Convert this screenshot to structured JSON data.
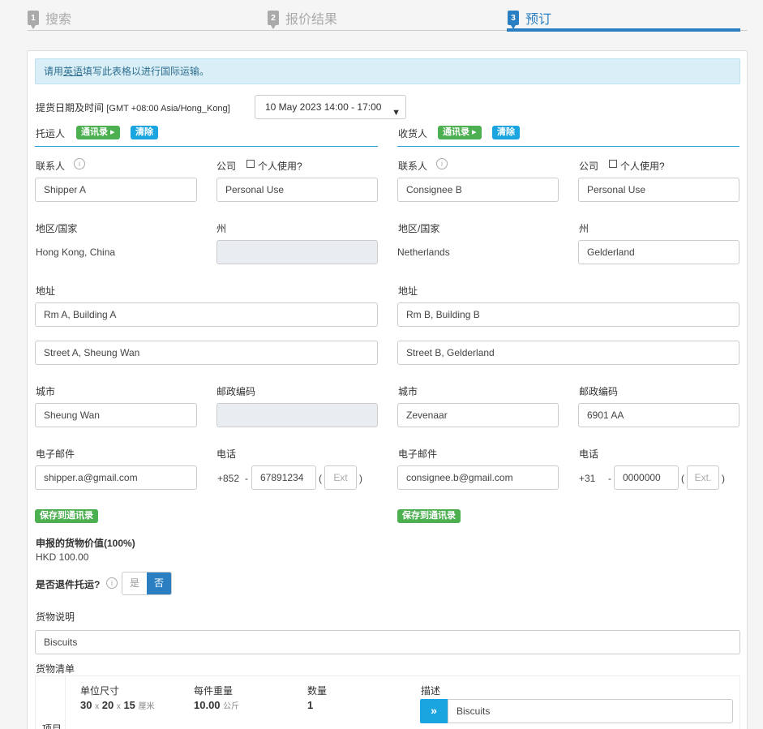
{
  "steps": [
    {
      "num": "1",
      "label": "搜索"
    },
    {
      "num": "2",
      "label": "报价结果"
    },
    {
      "num": "3",
      "label": "预订"
    }
  ],
  "notice": {
    "prefix": "请用",
    "link": "英语",
    "suffix": "填写此表格以进行国际运输。"
  },
  "pickup": {
    "label": "提货日期及时间",
    "timezone": "[GMT +08:00 Asia/Hong_Kong]",
    "value": "10 May 2023 14:00 - 17:00"
  },
  "shipper": {
    "title": "托运人",
    "address_book": "通讯录 ▸",
    "clear": "清除",
    "contact_label": "联系人",
    "contact": "Shipper A",
    "company_label": "公司",
    "personal_label": "个人使用?",
    "company": "Personal Use",
    "region_label": "地区/国家",
    "region": "Hong Kong, China",
    "state_label": "州",
    "state": "",
    "address_label": "地址",
    "address1": "Rm A, Building A",
    "address2": "Street A, Sheung Wan",
    "city_label": "城市",
    "city": "Sheung Wan",
    "postcode_label": "邮政编码",
    "postcode": "",
    "email_label": "电子邮件",
    "email": "shipper.a@gmail.com",
    "phone_label": "电话",
    "phone_code": "+852",
    "phone_dash": "-",
    "phone": "67891234",
    "ext_open": "(",
    "ext": "Ext",
    "ext_close": ")",
    "save": "保存到通讯录"
  },
  "consignee": {
    "title": "收货人",
    "address_book": "通讯录 ▸",
    "clear": "清除",
    "contact_label": "联系人",
    "contact": "Consignee B",
    "company_label": "公司",
    "personal_label": "个人使用?",
    "company": "Personal Use",
    "region_label": "地区/国家",
    "region": "Netherlands",
    "state_label": "州",
    "state": "Gelderland",
    "address_label": "地址",
    "address1": "Rm B, Building B",
    "address2": "Street B, Gelderland",
    "city_label": "城市",
    "city": "Zevenaar",
    "postcode_label": "邮政编码",
    "postcode": "6901 AA",
    "email_label": "电子邮件",
    "email": "consignee.b@gmail.com",
    "phone_label": "电话",
    "phone_code": "+31",
    "phone_dash": "-",
    "phone": "0000000",
    "ext_open": "(",
    "ext": "Ext.",
    "ext_close": ")",
    "save": "保存到通讯录"
  },
  "declared": {
    "label": "申报的货物价值(100%)",
    "value": "HKD 100.00"
  },
  "return": {
    "label": "是否退件托运?",
    "yes": "是",
    "no": "否",
    "selected": "否"
  },
  "goods": {
    "label": "货物说明",
    "value": "Biscuits"
  },
  "items": {
    "label": "货物清单",
    "side": "项目",
    "dim_label": "单位尺寸",
    "dim_a": "30",
    "x1": "x",
    "dim_b": "20",
    "x2": "x",
    "dim_c": "15",
    "dim_unit": "厘米",
    "weight_label": "每件重量",
    "weight": "10.00",
    "weight_unit": "公斤",
    "qty_label": "数量",
    "qty": "1",
    "desc_label": "描述",
    "desc": "Biscuits",
    "arrow": "»"
  },
  "colors": {
    "primary": "#2a7fc2",
    "green": "#4caf50",
    "cyan": "#1ba5e0",
    "notice_bg": "#d9eef6"
  }
}
